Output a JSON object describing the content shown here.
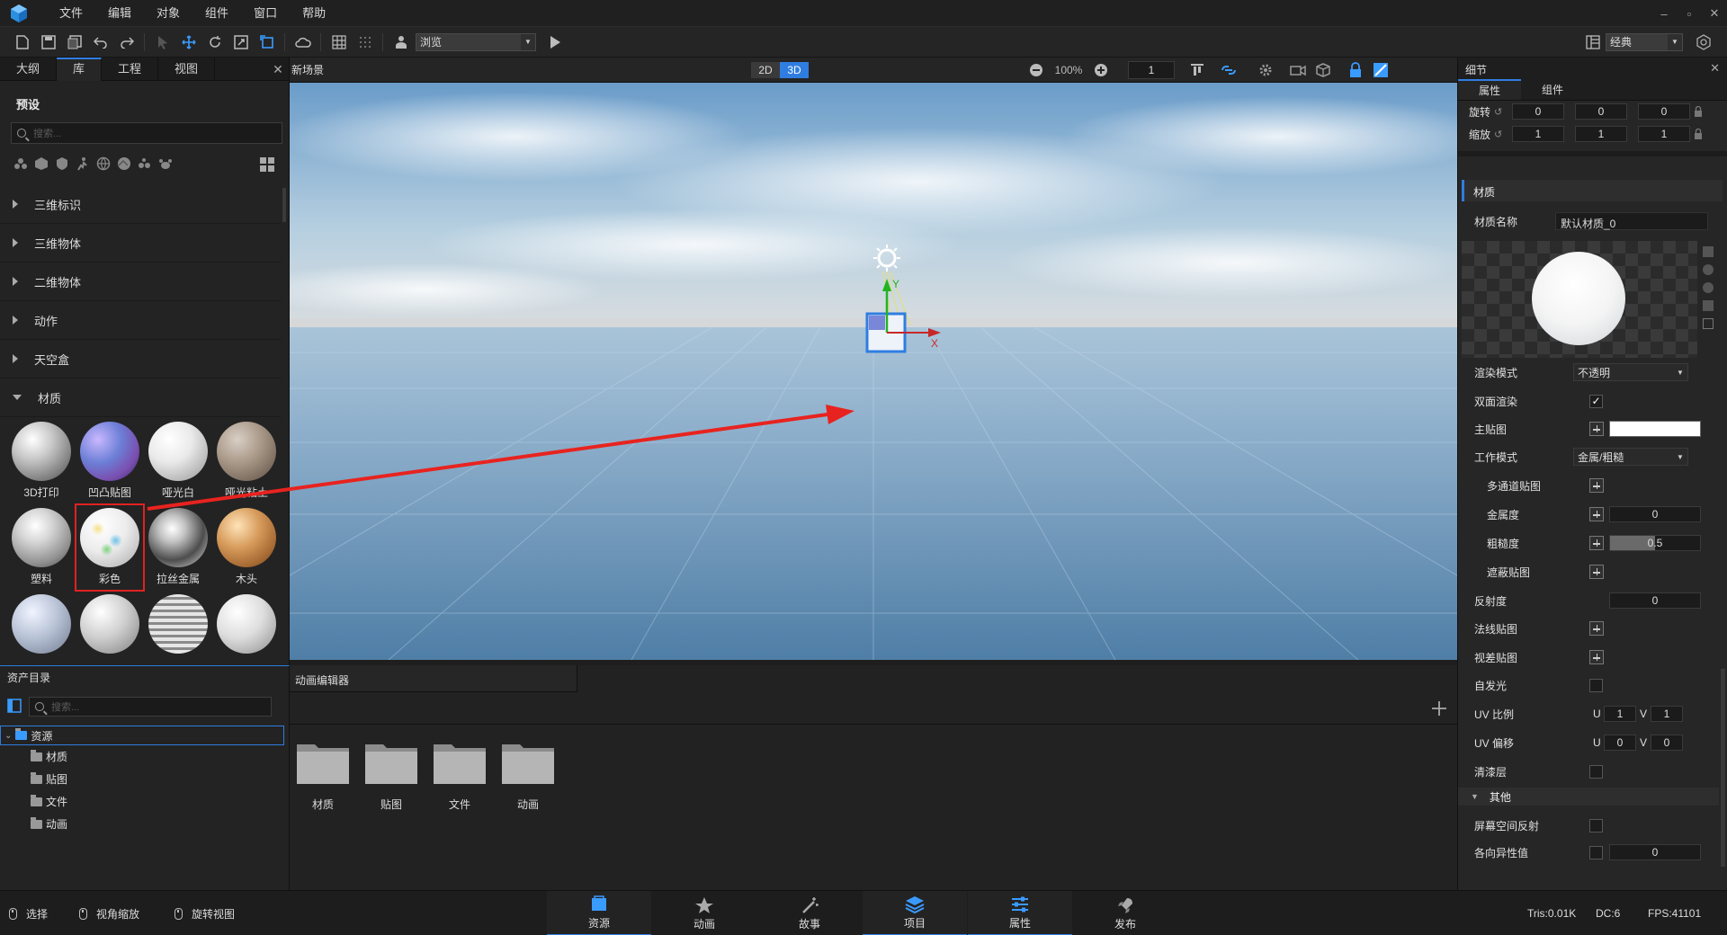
{
  "menu": [
    "文件",
    "编辑",
    "对象",
    "组件",
    "窗口",
    "帮助"
  ],
  "toolbar": {
    "browse_label": "浏览",
    "layout_label": "经典"
  },
  "left_tabs": [
    "大纲",
    "库",
    "工程",
    "视图"
  ],
  "library": {
    "section_title": "预设",
    "search_placeholder": "搜索...",
    "categories": [
      "三维标识",
      "三维物体",
      "二维物体",
      "动作",
      "天空盒",
      "材质"
    ],
    "materials": [
      "3D打印",
      "凹凸贴图",
      "哑光白",
      "哑光粘土",
      "塑料",
      "彩色",
      "拉丝金属",
      "木头",
      "",
      "",
      "",
      ""
    ],
    "selected_material": "彩色"
  },
  "asset_dir": {
    "title": "资产目录",
    "search_placeholder": "搜索...",
    "root": "资源",
    "children": [
      "材质",
      "贴图",
      "文件",
      "动画"
    ]
  },
  "scene": {
    "title": "新场景",
    "mode_2d": "2D",
    "mode_3d": "3D",
    "zoom": "100%",
    "speed": "1",
    "axis_x": "X",
    "axis_y": "Y"
  },
  "anim": {
    "title": "动画编辑器",
    "folders": [
      "材质",
      "贴图",
      "文件",
      "动画"
    ]
  },
  "details": {
    "title": "细节",
    "tabs": [
      "属性",
      "组件"
    ],
    "rotation_label": "旋转",
    "rotation": [
      "0",
      "0",
      "0"
    ],
    "scale_label": "缩放",
    "scale": [
      "1",
      "1",
      "1"
    ],
    "material_section": "材质",
    "material_name_label": "材质名称",
    "material_name": "默认材质_0",
    "render_mode_label": "渲染模式",
    "render_mode": "不透明",
    "double_sided_label": "双面渲染",
    "main_tex_label": "主贴图",
    "work_mode_label": "工作模式",
    "work_mode": "金属/粗糙",
    "multichannel_label": "多通道贴图",
    "metalness_label": "金属度",
    "metalness": "0",
    "roughness_label": "粗糙度",
    "roughness": "0.5",
    "occlusion_label": "遮蔽贴图",
    "reflectivity_label": "反射度",
    "reflectivity": "0",
    "normal_label": "法线贴图",
    "parallax_label": "视差贴图",
    "emissive_label": "自发光",
    "uv_scale_label": "UV 比例",
    "uv_scale": [
      "1",
      "1"
    ],
    "uv_offset_label": "UV 偏移",
    "uv_offset": [
      "0",
      "0"
    ],
    "u": "U",
    "v": "V",
    "clearcoat_label": "清漆层",
    "other_section": "其他",
    "ssr_label": "屏幕空间反射",
    "aniso_label": "各向异性值",
    "aniso": "0"
  },
  "status": {
    "hints": [
      "选择",
      "视角缩放",
      "旋转视图"
    ],
    "tabs": [
      "资源",
      "动画",
      "故事",
      "项目",
      "属性",
      "发布"
    ],
    "tris": "Tris:0.01K",
    "dc": "DC:6",
    "fps": "FPS:41101"
  },
  "colors": {
    "accent": "#2f7de1",
    "selection": "#e02222",
    "arrow": "#e8231f"
  }
}
